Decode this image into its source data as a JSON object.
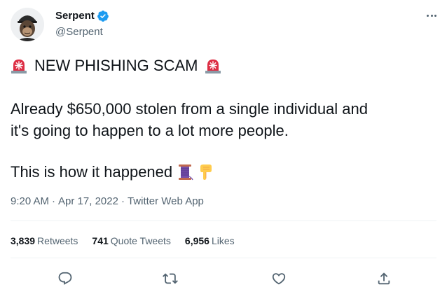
{
  "author": {
    "display_name": "Serpent",
    "handle": "@Serpent",
    "verified": true,
    "avatar_icon": "ape-avatar"
  },
  "tweet": {
    "line1_text": "NEW PHISHING SCAM",
    "line2_text": "Already $650,000 stolen from a single individual and",
    "line3_text": "it's going to happen to a lot more people.",
    "line4_text": "This is how it happened",
    "emojis": [
      "rotating-light-emoji",
      "thread-emoji",
      "point-down-emoji"
    ]
  },
  "meta": {
    "time": "9:20 AM",
    "date": "Apr 17, 2022",
    "source": "Twitter Web App",
    "separator": "·"
  },
  "stats": {
    "retweets_count": "3,839",
    "retweets_label": "Retweets",
    "quotes_count": "741",
    "quotes_label": "Quote Tweets",
    "likes_count": "6,956",
    "likes_label": "Likes"
  },
  "actions": [
    "reply-icon",
    "retweet-icon",
    "like-icon",
    "share-icon"
  ],
  "colors": {
    "text": "#0f1419",
    "secondary": "#536471",
    "verified": "#1d9bf0",
    "divider": "#eff3f4"
  }
}
